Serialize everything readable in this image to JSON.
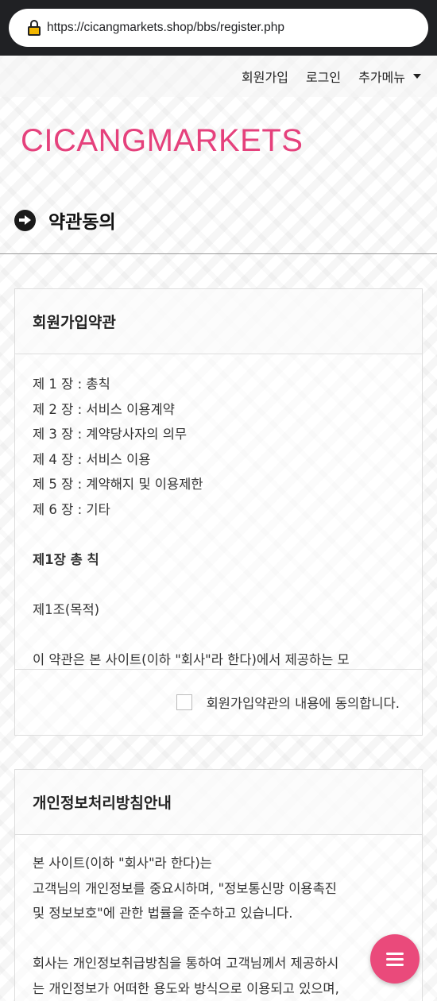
{
  "browser": {
    "url": "https://cicangmarkets.shop/bbs/register.php"
  },
  "nav": {
    "items": [
      "회원가입",
      "로그인",
      "추가메뉴"
    ]
  },
  "logo": "CICANGMARKETS",
  "page_title": "약관동의",
  "terms": {
    "title": "회원가입약관",
    "chapters": [
      "제 1 장 : 총칙",
      "제 2 장 : 서비스 이용계약",
      "제 3 장 : 계약당사자의 의무",
      "제 4 장 : 서비스 이용",
      "제 5 장 : 계약해지 및 이용제한",
      "제 6 장 : 기타"
    ],
    "section_heading": "제1장 총 칙",
    "article": "제1조(목적)",
    "clipped_line": "이 약관은 본 사이트(이하 \"회사\"라 한다)에서 제공하는 모",
    "agree_label": "회원가입약관의 내용에 동의합니다."
  },
  "privacy": {
    "title": "개인정보처리방침안내",
    "lines": [
      "본 사이트(이하 \"회사\"라 한다)는",
      "고객님의 개인정보를 중요시하며, \"정보통신망 이용촉진",
      "및 정보보호\"에 관한 법률을 준수하고 있습니다."
    ],
    "lines2": [
      "회사는 개인정보취급방침을 통하여 고객님께서 제공하시",
      "는 개인정보가 어떠한 용도와 방식으로 이용되고 있으며,"
    ]
  },
  "colors": {
    "brand": "#e5417c",
    "fab": "#ea4a7b"
  }
}
